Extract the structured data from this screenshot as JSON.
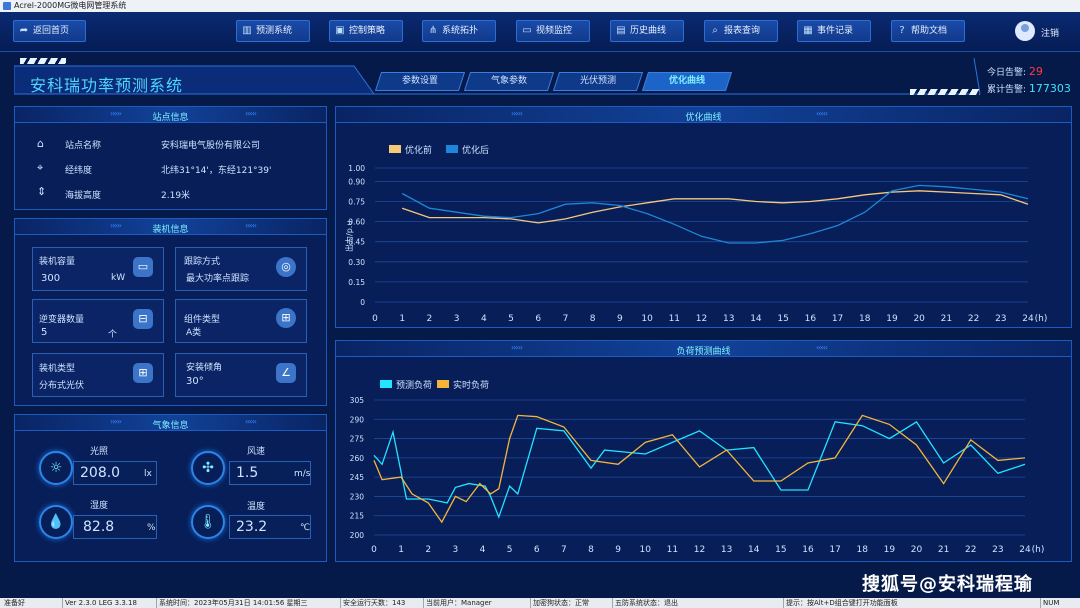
{
  "window_title": "Acrel-2000MG微电网管理系统",
  "nav": {
    "home": "返回首页",
    "items": [
      "预测系统",
      "控制策略",
      "系统拓扑",
      "视频监控",
      "历史曲线",
      "报表查询",
      "事件记录",
      "帮助文档"
    ],
    "user": "注销"
  },
  "system_title": "安科瑞功率预测系统",
  "tabs": [
    "参数设置",
    "气象参数",
    "光伏预测",
    "优化曲线"
  ],
  "active_tab": "优化曲线",
  "alarms": {
    "today_label": "今日告警:",
    "today_value": "29",
    "total_label": "累计告警:",
    "total_value": "177303"
  },
  "station": {
    "title": "站点信息",
    "rows": [
      {
        "icon": "home-icon",
        "label": "站点名称",
        "value": "安科瑞电气股份有限公司"
      },
      {
        "icon": "crosshair-icon",
        "label": "经纬度",
        "value": "北纬31°14'，东经121°39'"
      },
      {
        "icon": "altitude-icon",
        "label": "海拔高度",
        "value": "2.19米"
      }
    ]
  },
  "install": {
    "title": "装机信息",
    "cards": [
      {
        "label": "装机容量",
        "value": "300",
        "unit": "kW",
        "icon": "battery-icon"
      },
      {
        "label": "跟踪方式",
        "value": "最大功率点跟踪",
        "unit": "",
        "icon": "target-icon"
      },
      {
        "label": "逆变器数量",
        "value": "5",
        "unit": "个",
        "icon": "inverter-icon"
      },
      {
        "label": "组件类型",
        "value": "A类",
        "unit": "",
        "icon": "grid-icon"
      },
      {
        "label": "装机类型",
        "value": "分布式光伏",
        "unit": "",
        "icon": "layout-icon"
      },
      {
        "label": "安装倾角",
        "value": "30°",
        "unit": "",
        "icon": "angle-icon"
      }
    ]
  },
  "weather": {
    "title": "气象信息",
    "items": [
      {
        "label": "光照",
        "value": "208.0",
        "unit": "lx",
        "icon": "sun-icon"
      },
      {
        "label": "风速",
        "value": "1.5",
        "unit": "m/s",
        "icon": "fan-icon"
      },
      {
        "label": "湿度",
        "value": "82.8",
        "unit": "%",
        "icon": "humidity-icon"
      },
      {
        "label": "温度",
        "value": "23.2",
        "unit": "℃",
        "icon": "thermometer-icon"
      }
    ]
  },
  "chart_data": [
    {
      "type": "line",
      "title": "优化曲线",
      "ylabel": "出力/p.u.",
      "xlabel": "",
      "x_unit": "(h)",
      "ylim": [
        0,
        1.0
      ],
      "yticks": [
        "0",
        "0.15",
        "0.30",
        "0.45",
        "0.60",
        "0.75",
        "0.90",
        "1.00"
      ],
      "x": [
        0,
        1,
        2,
        3,
        4,
        5,
        6,
        7,
        8,
        9,
        10,
        11,
        12,
        13,
        14,
        15,
        16,
        17,
        18,
        19,
        20,
        21,
        22,
        23,
        24
      ],
      "legend_position": "top-left",
      "series": [
        {
          "name": "优化前",
          "color": "#f6c97a",
          "values": [
            null,
            0.7,
            0.63,
            0.63,
            0.63,
            0.62,
            0.59,
            0.62,
            0.67,
            0.71,
            0.74,
            0.77,
            0.77,
            0.77,
            0.75,
            0.74,
            0.75,
            0.77,
            0.8,
            0.82,
            0.83,
            0.82,
            0.81,
            0.8,
            0.73
          ]
        },
        {
          "name": "优化后",
          "color": "#1e86d8",
          "values": [
            null,
            0.81,
            0.7,
            0.67,
            0.64,
            0.63,
            0.66,
            0.73,
            0.74,
            0.72,
            0.66,
            0.58,
            0.49,
            0.44,
            0.44,
            0.46,
            0.51,
            0.57,
            0.67,
            0.83,
            0.87,
            0.86,
            0.84,
            0.82,
            0.77
          ]
        }
      ]
    },
    {
      "type": "line",
      "title": "负荷预测曲线",
      "xlabel": "",
      "x_unit": "(h)",
      "ylim": [
        200,
        305
      ],
      "yticks": [
        "200",
        "215",
        "230",
        "245",
        "260",
        "275",
        "290",
        "305"
      ],
      "legend_position": "top-left",
      "series": [
        {
          "name": "预测负荷",
          "color": "#22e4ff",
          "x": [
            0,
            0.3,
            0.7,
            1.2,
            2,
            2.7,
            3,
            3.5,
            4.1,
            4.3,
            4.6,
            5,
            5.3,
            6,
            7,
            8,
            8.5,
            9,
            10,
            11,
            12,
            13,
            14,
            15,
            16,
            17,
            18,
            19,
            20,
            21,
            22,
            23,
            24
          ],
          "values": [
            262,
            255,
            280,
            228,
            228,
            225,
            237,
            240,
            238,
            230,
            214,
            238,
            232,
            283,
            281,
            252,
            266,
            265,
            263,
            272,
            281,
            266,
            268,
            235,
            235,
            288,
            285,
            275,
            288,
            256,
            270,
            248,
            255
          ]
        },
        {
          "name": "实时负荷",
          "color": "#f4b63a",
          "x": [
            0,
            0.3,
            1,
            1.4,
            2,
            2.5,
            3,
            3.4,
            3.9,
            4.3,
            4.6,
            5,
            5.3,
            6,
            7,
            8,
            9,
            10,
            11,
            12,
            13,
            14,
            15,
            16,
            17,
            18,
            19,
            20,
            21,
            22,
            23,
            24
          ],
          "values": [
            258,
            243,
            245,
            232,
            225,
            210,
            230,
            226,
            240,
            232,
            236,
            275,
            293,
            292,
            284,
            258,
            255,
            272,
            278,
            253,
            266,
            242,
            242,
            256,
            260,
            293,
            286,
            270,
            240,
            274,
            258,
            260
          ]
        }
      ]
    }
  ],
  "statusbar": [
    "准备好",
    "Ver 2.3.0 LEG 3.3.18",
    "系统时间：2023年05月31日 14:01:56 星期三",
    "安全运行天数：143",
    "当前用户：Manager",
    "加密狗状态：正常",
    "五防系统状态：退出",
    "提示：按Alt+D组合键打开功能面板",
    "NUM"
  ],
  "watermark": "搜狐号@安科瑞程瑜"
}
